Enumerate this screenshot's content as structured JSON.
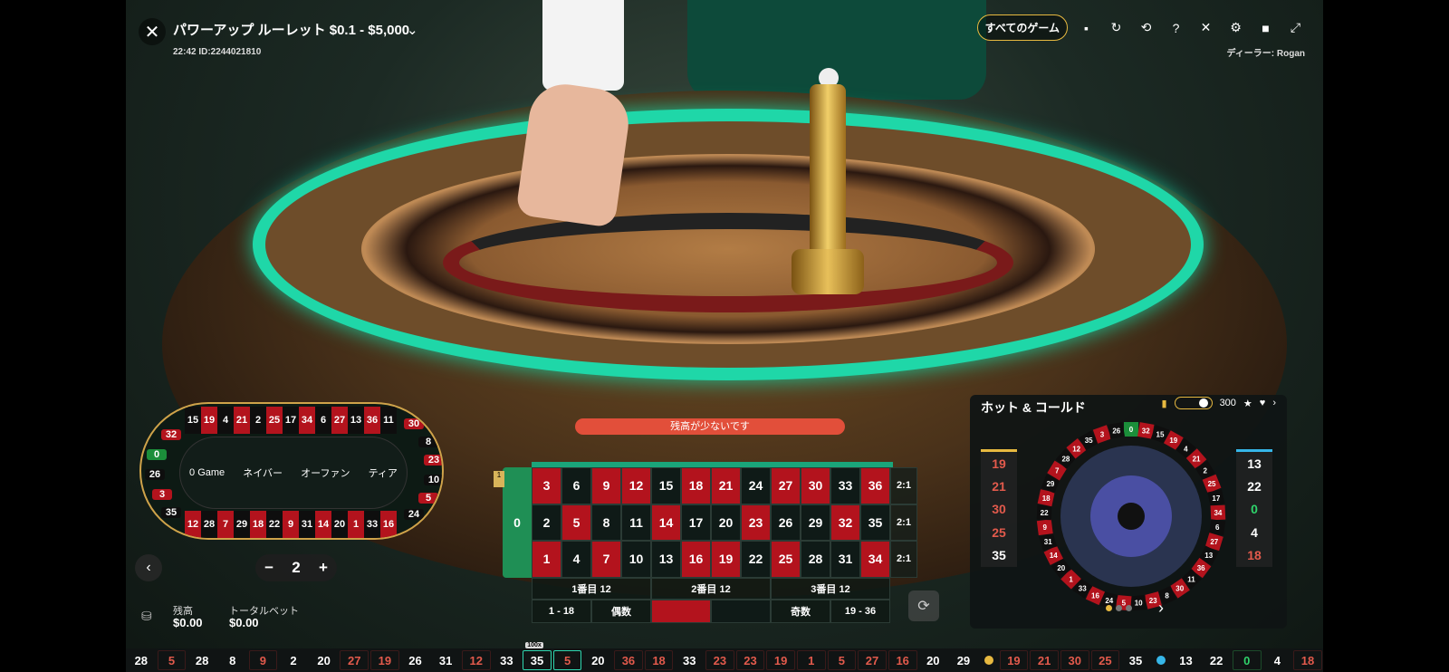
{
  "header": {
    "title": "パワーアップ ルーレット  $0.1 - $5,000",
    "round_info": "22:42 ID:2244021810",
    "all_games_label": "すべてのゲーム",
    "dealer": "ディーラー: Rogan",
    "icons": [
      "chat-icon",
      "rebet-history-icon",
      "history-icon",
      "help-icon",
      "mute-icon",
      "settings-icon",
      "video-icon",
      "fullscreen-icon"
    ]
  },
  "racetrack": {
    "top_row": [
      [
        "15",
        "b"
      ],
      [
        "19",
        "r"
      ],
      [
        "4",
        "b"
      ],
      [
        "21",
        "r"
      ],
      [
        "2",
        "b"
      ],
      [
        "25",
        "r"
      ],
      [
        "17",
        "b"
      ],
      [
        "34",
        "r"
      ],
      [
        "6",
        "b"
      ],
      [
        "27",
        "r"
      ],
      [
        "13",
        "b"
      ],
      [
        "36",
        "r"
      ],
      [
        "11",
        "b"
      ]
    ],
    "bottom_row": [
      [
        "12",
        "r"
      ],
      [
        "28",
        "b"
      ],
      [
        "7",
        "r"
      ],
      [
        "29",
        "b"
      ],
      [
        "18",
        "r"
      ],
      [
        "22",
        "b"
      ],
      [
        "9",
        "r"
      ],
      [
        "31",
        "b"
      ],
      [
        "14",
        "r"
      ],
      [
        "20",
        "b"
      ],
      [
        "1",
        "r"
      ],
      [
        "33",
        "b"
      ],
      [
        "16",
        "r"
      ]
    ],
    "left_side": [
      [
        "32",
        "r"
      ],
      [
        "0",
        "g"
      ],
      [
        "26",
        "b"
      ],
      [
        "3",
        "r"
      ],
      [
        "35",
        "b"
      ]
    ],
    "right_side": [
      [
        "30",
        "r"
      ],
      [
        "8",
        "b"
      ],
      [
        "23",
        "r"
      ],
      [
        "10",
        "b"
      ],
      [
        "5",
        "r"
      ],
      [
        "24",
        "b"
      ]
    ],
    "sections": [
      "0 Game",
      "ネイバー",
      "オーファン",
      "ティア"
    ]
  },
  "controls": {
    "chip_value": "2",
    "minus": "−",
    "plus": "+",
    "balance_label": "残高",
    "balance_value": "$0.00",
    "total_bet_label": "トータルベット",
    "total_bet_value": "$0.00"
  },
  "warning": "残高が少ないです",
  "table": {
    "zero": "0",
    "rows": [
      [
        [
          "3",
          "r"
        ],
        [
          "6",
          "b"
        ],
        [
          "9",
          "r"
        ],
        [
          "12",
          "r"
        ],
        [
          "15",
          "b"
        ],
        [
          "18",
          "r"
        ],
        [
          "21",
          "r"
        ],
        [
          "24",
          "b"
        ],
        [
          "27",
          "r"
        ],
        [
          "30",
          "r"
        ],
        [
          "33",
          "b"
        ],
        [
          "36",
          "r"
        ]
      ],
      [
        [
          "2",
          "b"
        ],
        [
          "5",
          "r"
        ],
        [
          "8",
          "b"
        ],
        [
          "11",
          "b"
        ],
        [
          "14",
          "r"
        ],
        [
          "17",
          "b"
        ],
        [
          "20",
          "b"
        ],
        [
          "23",
          "r"
        ],
        [
          "26",
          "b"
        ],
        [
          "29",
          "b"
        ],
        [
          "32",
          "r"
        ],
        [
          "35",
          "b"
        ]
      ],
      [
        [
          "1",
          "r"
        ],
        [
          "4",
          "b"
        ],
        [
          "7",
          "r"
        ],
        [
          "10",
          "b"
        ],
        [
          "13",
          "b"
        ],
        [
          "16",
          "r"
        ],
        [
          "19",
          "r"
        ],
        [
          "22",
          "b"
        ],
        [
          "25",
          "r"
        ],
        [
          "28",
          "b"
        ],
        [
          "31",
          "b"
        ],
        [
          "34",
          "r"
        ]
      ]
    ],
    "column_bets": [
      "2:1",
      "2:1",
      "2:1"
    ],
    "dozens": [
      "1番目 12",
      "2番目 12",
      "3番目 12"
    ],
    "outside": [
      "1 - 18",
      "偶数",
      "",
      "",
      "奇数",
      "19 - 36"
    ]
  },
  "hot_cold": {
    "title": "ホット & コールド",
    "count": "300",
    "hot": [
      [
        "19",
        "r"
      ],
      [
        "21",
        "r"
      ],
      [
        "30",
        "r"
      ],
      [
        "25",
        "r"
      ],
      [
        "35",
        "b"
      ]
    ],
    "cold": [
      [
        "13",
        "b"
      ],
      [
        "22",
        "b"
      ],
      [
        "0",
        "g"
      ],
      [
        "4",
        "b"
      ],
      [
        "18",
        "r"
      ]
    ],
    "wheel": [
      "0",
      "32",
      "15",
      "19",
      "4",
      "21",
      "2",
      "25",
      "17",
      "34",
      "6",
      "27",
      "13",
      "36",
      "11",
      "30",
      "8",
      "23",
      "10",
      "5",
      "24",
      "16",
      "33",
      "1",
      "20",
      "14",
      "31",
      "9",
      "22",
      "18",
      "29",
      "7",
      "28",
      "12",
      "35",
      "3",
      "26"
    ]
  },
  "history": {
    "items": [
      [
        "28",
        "b"
      ],
      [
        "5",
        "r"
      ],
      [
        "28",
        "b"
      ],
      [
        "8",
        "b"
      ],
      [
        "9",
        "r"
      ],
      [
        "2",
        "b"
      ],
      [
        "20",
        "b"
      ],
      [
        "27",
        "r"
      ],
      [
        "19",
        "r"
      ],
      [
        "26",
        "b"
      ],
      [
        "31",
        "b"
      ],
      [
        "12",
        "r"
      ],
      [
        "33",
        "b"
      ],
      [
        "35",
        "b"
      ],
      [
        "5",
        "r"
      ],
      [
        "20",
        "b"
      ],
      [
        "36",
        "r"
      ],
      [
        "18",
        "r"
      ],
      [
        "33",
        "b"
      ],
      [
        "23",
        "r"
      ],
      [
        "23",
        "r"
      ],
      [
        "19",
        "r"
      ],
      [
        "1",
        "r"
      ],
      [
        "5",
        "r"
      ],
      [
        "27",
        "r"
      ],
      [
        "16",
        "r"
      ],
      [
        "20",
        "b"
      ],
      [
        "29",
        "b"
      ]
    ],
    "boost_label": "100x",
    "hot_items": [
      [
        "19",
        "r"
      ],
      [
        "21",
        "r"
      ],
      [
        "30",
        "r"
      ],
      [
        "25",
        "r"
      ],
      [
        "35",
        "b"
      ]
    ],
    "cold_items": [
      [
        "13",
        "b"
      ],
      [
        "22",
        "b"
      ],
      [
        "0",
        "g"
      ],
      [
        "4",
        "b"
      ],
      [
        "18",
        "r"
      ]
    ]
  },
  "colors": {
    "accent": "#e7b940",
    "red": "#b3131d",
    "black": "#0f1a17",
    "green": "#1f8f55",
    "neon": "#1fd7a8"
  }
}
